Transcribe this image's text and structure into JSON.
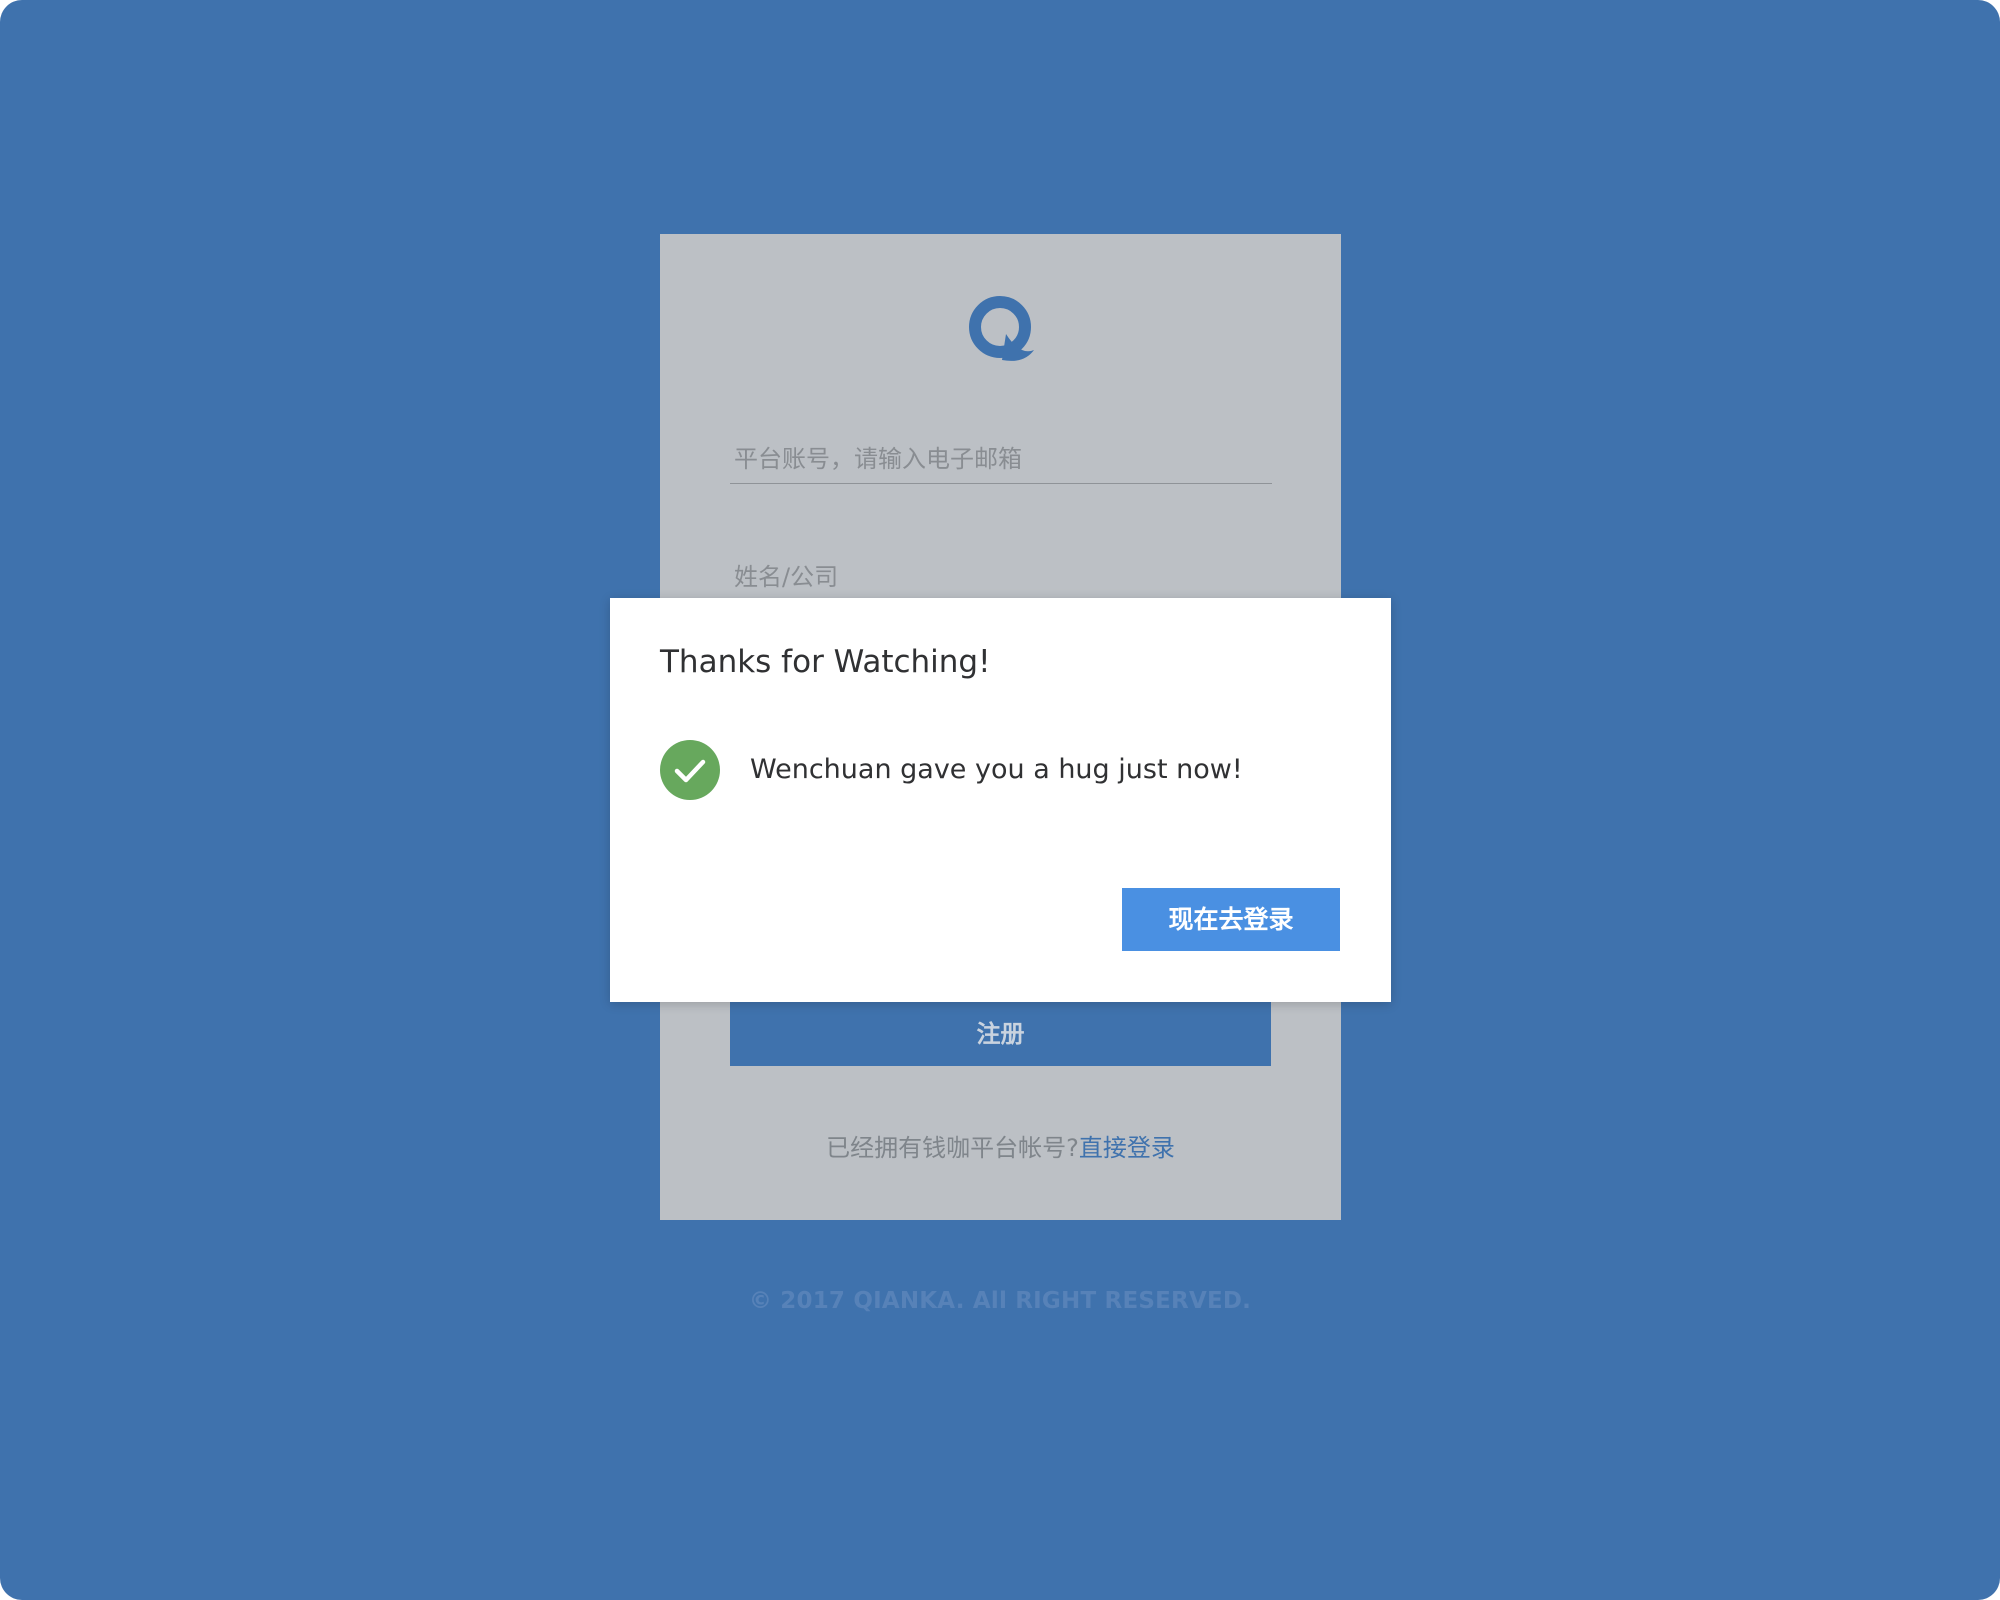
{
  "brand": {
    "logo_letter": "Q",
    "accent_color": "#3f72ad"
  },
  "form": {
    "email_placeholder": "平台账号，请输入电子邮箱",
    "name_placeholder": "姓名/公司",
    "register_label": "注册",
    "login_prompt": "已经拥有钱咖平台帐号?",
    "login_link": "直接登录"
  },
  "footer": {
    "copyright": "© 2017 QIANKA. All RIGHT RESERVED."
  },
  "dialog": {
    "title": "Thanks for Watching!",
    "message": "Wenchuan gave you a hug just now!",
    "status_icon": "check-circle-icon",
    "status_color": "#67a85d",
    "button_label": "现在去登录",
    "button_color": "#4a90e2"
  }
}
